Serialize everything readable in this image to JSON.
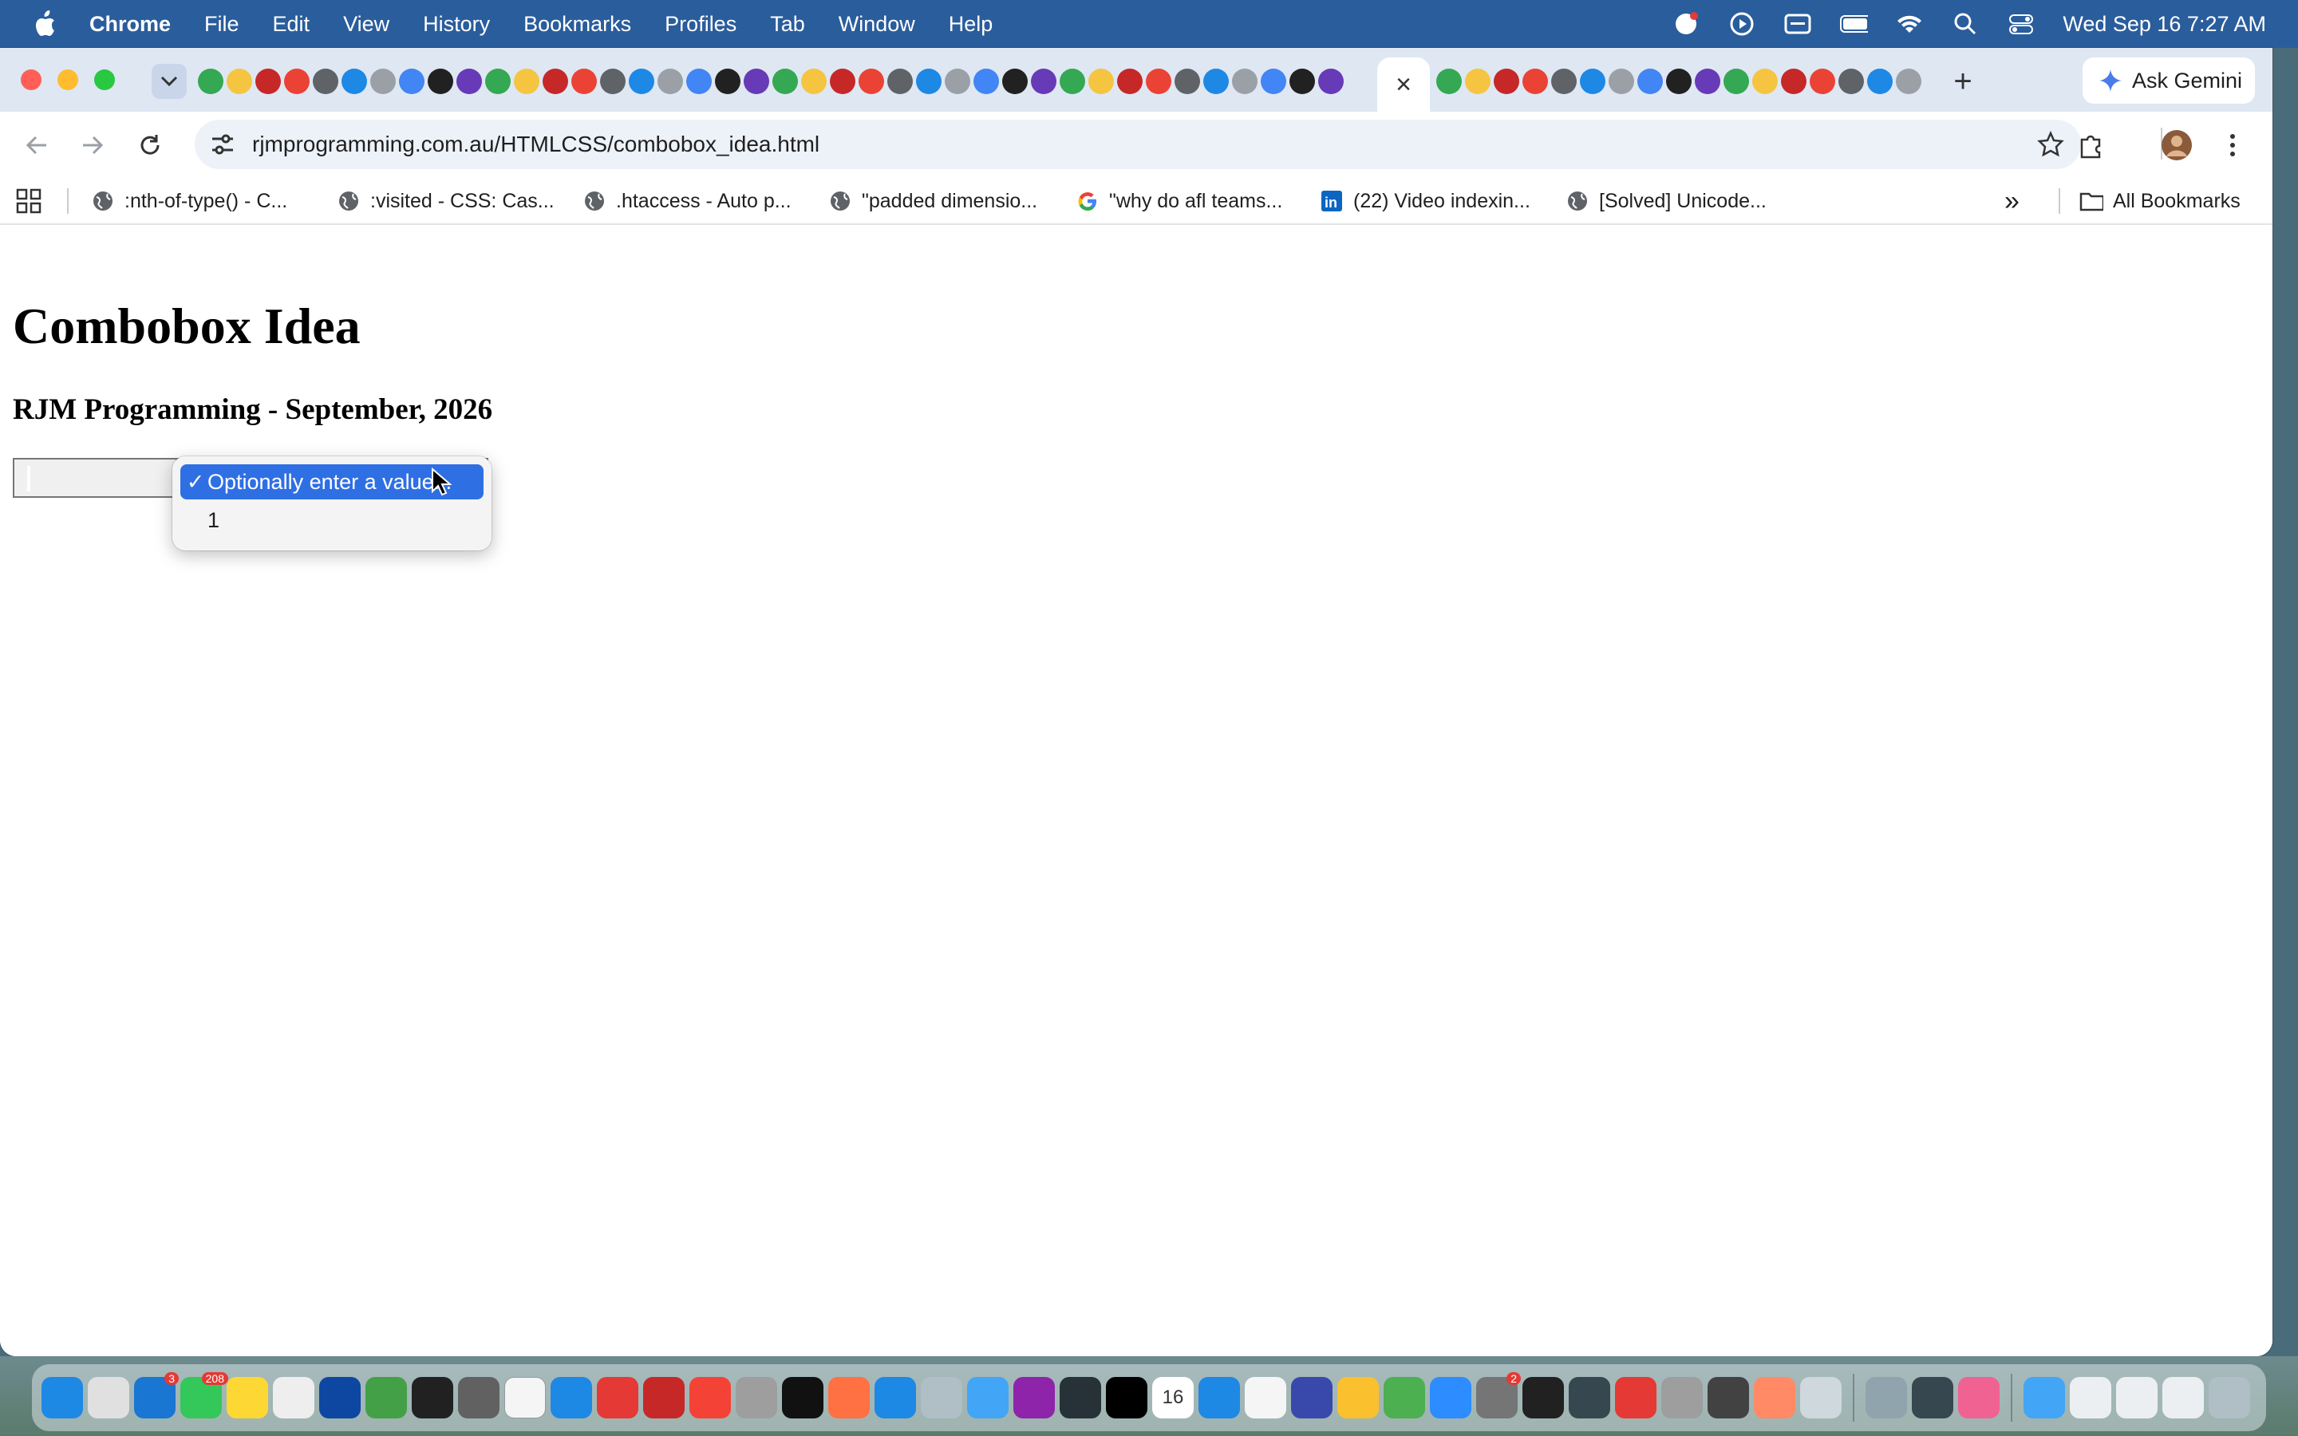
{
  "menubar": {
    "app_name": "Chrome",
    "items": [
      "File",
      "Edit",
      "View",
      "History",
      "Bookmarks",
      "Profiles",
      "Tab",
      "Window",
      "Help"
    ],
    "clock": "Wed Sep 16  7:27 AM"
  },
  "tabs": {
    "active_close": "×",
    "new_tab": "+",
    "ask_gemini": "Ask Gemini"
  },
  "toolbar": {
    "url": "rjmprogramming.com.au/HTMLCSS/combobox_idea.html"
  },
  "bookmarks": {
    "items": [
      ":nth-of-type() - C...",
      ":visited - CSS: Cas...",
      ".htaccess - Auto p...",
      "\"padded dimensio...",
      "\"why do afl teams...",
      "(22) Video indexin...",
      "[Solved] Unicode..."
    ],
    "more": "»",
    "all_bookmarks": "All Bookmarks"
  },
  "page": {
    "title": "Combobox Idea",
    "subtitle": "RJM Programming - September, 2026",
    "combobox": {
      "input_value": "",
      "options": [
        {
          "check": "✓",
          "label": "Optionally enter a value..."
        },
        {
          "check": "",
          "label": "1"
        }
      ]
    }
  },
  "dock": {
    "mail_badge": "3",
    "messages_badge": "208",
    "settings_badge": "2",
    "calendar_day": "16"
  },
  "colors": {
    "menubar_bg": "#2a5d9c",
    "tabstrip_bg": "#dfe7f3",
    "selection_blue": "#2f6fe4",
    "close_red": "#ff5f57",
    "minimize_yellow": "#febc2e",
    "zoom_green": "#28c840"
  }
}
